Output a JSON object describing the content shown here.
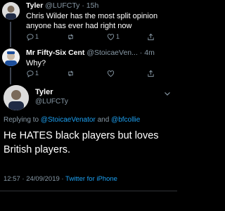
{
  "tweets": [
    {
      "name": "Tyler",
      "handle": "@LUFCTy",
      "time": "15h",
      "text": "Chris Wilder has the most split opinion anyone has ever had right now",
      "replies": "1",
      "likes": "1"
    },
    {
      "name": "Mr Fifty-Six Cent",
      "handle": "@StoicaeVen...",
      "time": "4m",
      "text": "Why?",
      "replies": "1"
    }
  ],
  "focus": {
    "name": "Tyler",
    "handle": "@LUFCTy",
    "replying_label": "Replying to ",
    "reply_to_1": "@StoicaeVenator",
    "reply_and": " and ",
    "reply_to_2": "@bfcollie",
    "text": "He HATES black players but loves British players.",
    "time": "12:57 · 24/09/2019 · ",
    "source": "Twitter for iPhone"
  },
  "colors": {
    "background": "#000000",
    "secondary_text": "#8899a6",
    "link": "#1da1f2"
  },
  "icons": [
    "reply-icon",
    "retweet-icon",
    "like-icon",
    "share-icon",
    "chevron-down-icon"
  ]
}
